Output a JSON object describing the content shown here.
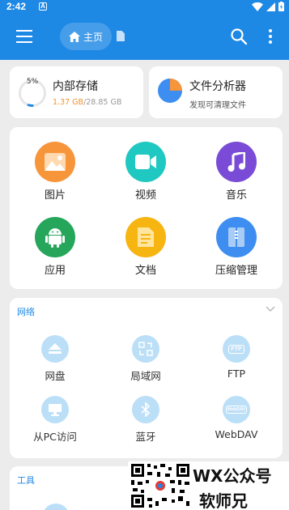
{
  "status_bar": {
    "time": "2:42",
    "notif_letter": "A"
  },
  "appbar": {
    "home_label": "主页"
  },
  "storage": {
    "title": "内部存储",
    "percent": "5",
    "percent_value": 0.05,
    "used": "1.37 GB",
    "total": "/28.85 GB"
  },
  "analyzer": {
    "title": "文件分析器",
    "subtitle": "发现可清理文件"
  },
  "categories": [
    {
      "label": "图片",
      "icon": "image-icon",
      "color": "#f7953b"
    },
    {
      "label": "视频",
      "icon": "video-icon",
      "color": "#1fc8c0"
    },
    {
      "label": "音乐",
      "icon": "music-icon",
      "color": "#7a4bd6"
    },
    {
      "label": "应用",
      "icon": "android-icon",
      "color": "#26a65b"
    },
    {
      "label": "文档",
      "icon": "document-icon",
      "color": "#f7b511"
    },
    {
      "label": "压缩管理",
      "icon": "archive-icon",
      "color": "#3d8ef0"
    }
  ],
  "network": {
    "title": "网络",
    "items": [
      {
        "label": "网盘",
        "icon": "cloud-drive-icon"
      },
      {
        "label": "局域网",
        "icon": "lan-icon"
      },
      {
        "label": "FTP",
        "icon": "ftp-icon",
        "badge": "FTP"
      },
      {
        "label": "从PC访问",
        "icon": "pc-access-icon"
      },
      {
        "label": "蓝牙",
        "icon": "bluetooth-icon"
      },
      {
        "label": "WebDAV",
        "icon": "webdav-icon",
        "badge": "WebDAV"
      }
    ]
  },
  "tools": {
    "title": "工具"
  },
  "watermark": {
    "line1": "WX公众号",
    "line2": "软师兄"
  },
  "colors": {
    "primary": "#1e88e5",
    "accent_orange": "#f0932b",
    "background": "#ececec"
  }
}
